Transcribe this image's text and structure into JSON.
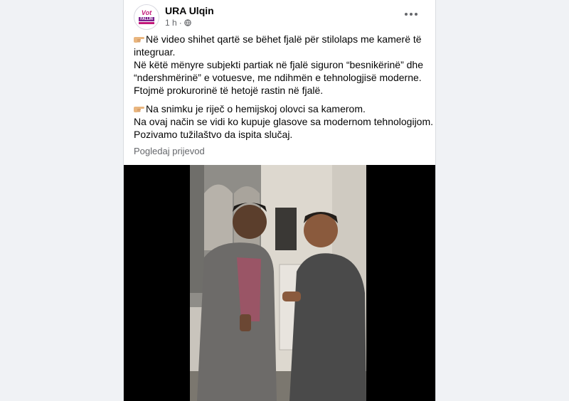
{
  "post": {
    "page_name": "URA Ulqin",
    "avatar": {
      "logo_lines": [
        "Vot",
        "FALLIN",
        ""
      ]
    },
    "time": "1 h",
    "separator": "·",
    "privacy_icon": "globe-icon",
    "more_icon": "more-horizontal-icon",
    "paragraphs": [
      {
        "emoji": "backhand-index-pointing-right-emoji",
        "lines": [
          "Në video shihet qartë se bëhet fjalë për stilolaps me kamerë të",
          "integruar.",
          "Në këtë mënyre subjekti partiak në fjalë siguron “besnikërinë” dhe",
          "“ndershmërinë” e votuesve, me ndihmën e tehnologjisë moderne.",
          "Ftojmë prokurorinë të hetojë rastin në fjalë."
        ]
      },
      {
        "emoji": "backhand-index-pointing-right-emoji",
        "lines": [
          "Na snimku je riječ o hemijskoj olovci sa kamerom.",
          "Na ovaj način se vidi ko kupuje glasove sa modernom tehnologijom.",
          "Pozivamo tužilaštvo da ispita slučaj."
        ]
      }
    ],
    "see_translation": "Pogledaj prijevod"
  },
  "colors": {
    "background": "#f0f2f5",
    "card": "#ffffff",
    "text_primary": "#050505",
    "text_secondary": "#65676b",
    "avatar_accent": "#c2187a"
  }
}
